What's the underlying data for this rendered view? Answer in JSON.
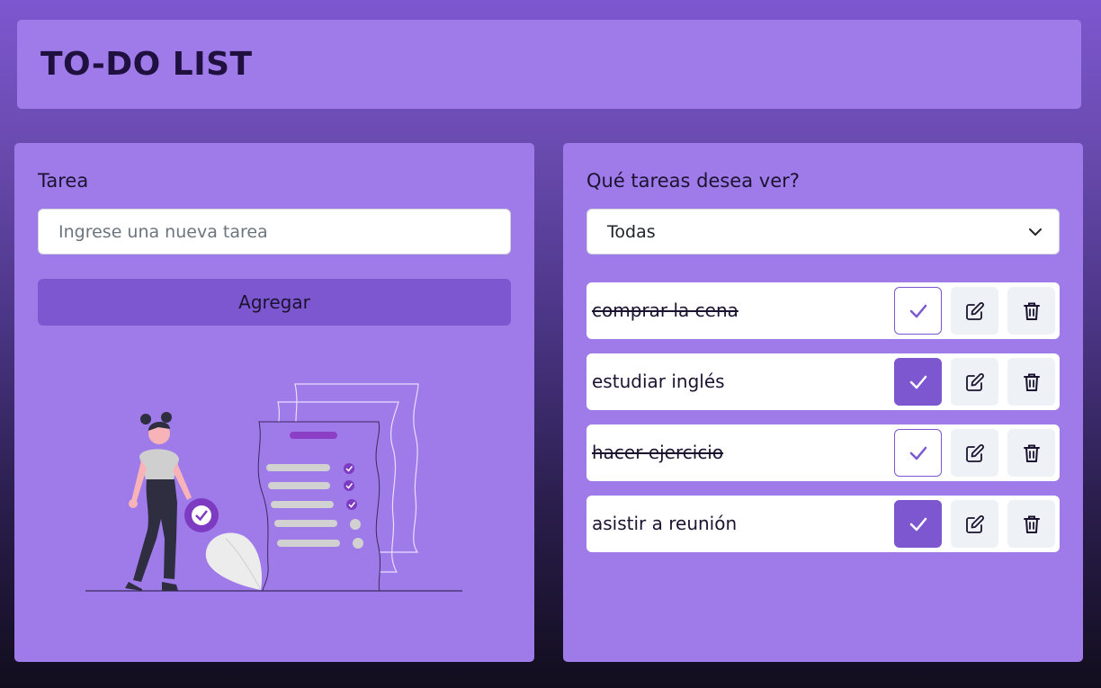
{
  "header": {
    "title": "TO-DO LIST"
  },
  "form": {
    "label": "Tarea",
    "placeholder": "Ingrese una nueva tarea",
    "add_label": "Agregar"
  },
  "filter": {
    "label": "Qué tareas desea ver?",
    "selected": "Todas"
  },
  "tasks": [
    {
      "text": "comprar la cena",
      "completed": true
    },
    {
      "text": "estudiar inglés",
      "completed": false
    },
    {
      "text": "hacer ejercicio",
      "completed": true
    },
    {
      "text": "asistir a reunión",
      "completed": false
    }
  ],
  "colors": {
    "accent": "#7d57cf",
    "card": "#9f7bea",
    "title": "#1f1040"
  },
  "icons": {
    "check": "check-icon",
    "edit": "edit-icon",
    "delete": "trash-icon",
    "chevron": "chevron-down-icon"
  }
}
